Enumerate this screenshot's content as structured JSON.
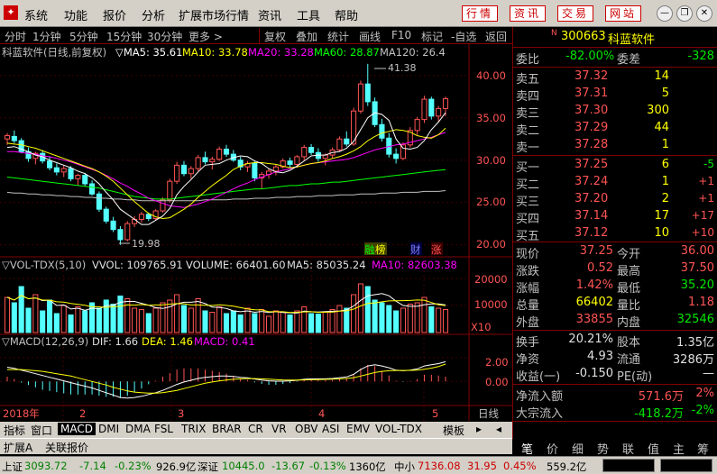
{
  "menu": {
    "items": [
      "系统",
      "功能",
      "报价",
      "分析",
      "扩展市场行情",
      "资讯",
      "工具",
      "帮助"
    ],
    "right_buttons": [
      "行情",
      "资讯",
      "交易",
      "网站"
    ]
  },
  "toolbar": {
    "periods": [
      "分时",
      "1分钟",
      "5分钟",
      "15分钟",
      "30分钟",
      "更多 >"
    ],
    "buttons": [
      "复权",
      "叠加",
      "统计",
      "画线",
      "F10",
      "标记",
      "-自选",
      "返回"
    ]
  },
  "main": {
    "title": "科蓝软件(日线,前复权)",
    "ma_labels": [
      "▽MA5: 35.61",
      "MA10: 33.78",
      "MA20: 33.28",
      "MA60: 28.87",
      "MA120: 26.4"
    ],
    "ma_colors": [
      "#ffffff",
      "#ffff00",
      "#ff00ff",
      "#00ff00",
      "#c0c0c0"
    ],
    "price_ticks": [
      "40.00",
      "35.00",
      "30.00",
      "25.00",
      "20.00"
    ],
    "high_label": "41.38",
    "low_label": "19.98",
    "marks": [
      "融",
      "榜",
      "财",
      "涨"
    ]
  },
  "volume": {
    "title": "▽VOL-TDX(5,10)",
    "labels": [
      "VVOL: 109765.91",
      "VOLUME: 66401.60",
      "MA5: 85035.24",
      "MA10: 82603.38"
    ],
    "ticks": [
      "20000",
      "10000",
      "X10"
    ]
  },
  "macd": {
    "title": "▽MACD(12,26,9)",
    "labels": [
      "DIF: 1.66",
      "DEA: 1.46",
      "MACD: 0.41"
    ],
    "ticks": [
      "2.00",
      "0.00"
    ]
  },
  "xaxis": {
    "labels": [
      "2018年",
      "2",
      "3",
      "4",
      "5"
    ],
    "period_label": "日线"
  },
  "quote": {
    "code": "300663",
    "name": "科蓝软件",
    "weibi_label": "委比",
    "weibi": "-82.00%",
    "weicha_label": "委差",
    "weicha": "-328",
    "asks": [
      {
        "label": "卖五",
        "price": "37.32",
        "vol": "14"
      },
      {
        "label": "卖四",
        "price": "37.31",
        "vol": "5"
      },
      {
        "label": "卖三",
        "price": "37.30",
        "vol": "300"
      },
      {
        "label": "卖二",
        "price": "37.29",
        "vol": "44"
      },
      {
        "label": "卖一",
        "price": "37.28",
        "vol": "1"
      }
    ],
    "bids": [
      {
        "label": "买一",
        "price": "37.25",
        "vol": "6",
        "chg": "-5"
      },
      {
        "label": "买二",
        "price": "37.24",
        "vol": "1",
        "chg": "+1"
      },
      {
        "label": "买三",
        "price": "37.20",
        "vol": "2",
        "chg": "+1"
      },
      {
        "label": "买四",
        "price": "37.14",
        "vol": "17",
        "chg": "+17"
      },
      {
        "label": "买五",
        "price": "37.12",
        "vol": "10",
        "chg": "+10"
      }
    ],
    "stats": [
      {
        "l1": "现价",
        "v1": "37.25",
        "l2": "今开",
        "v2": "36.00",
        "c1": "red",
        "c2": "red"
      },
      {
        "l1": "涨跌",
        "v1": "0.52",
        "l2": "最高",
        "v2": "37.50",
        "c1": "red",
        "c2": "red"
      },
      {
        "l1": "涨幅",
        "v1": "1.42%",
        "l2": "最低",
        "v2": "35.20",
        "c1": "red",
        "c2": "grn"
      },
      {
        "l1": "总量",
        "v1": "66402",
        "l2": "量比",
        "v2": "1.18",
        "c1": "yel",
        "c2": "red"
      },
      {
        "l1": "外盘",
        "v1": "33855",
        "l2": "内盘",
        "v2": "32546",
        "c1": "red",
        "c2": "grn"
      }
    ],
    "stats2": [
      {
        "l1": "换手",
        "v1": "20.21%",
        "l2": "股本",
        "v2": "1.35亿"
      },
      {
        "l1": "净资",
        "v1": "4.93",
        "l2": "流通",
        "v2": "3286万"
      },
      {
        "l1": "收益(一)",
        "v1": "-0.150",
        "l2": "PE(动)",
        "v2": "—"
      }
    ],
    "flow": [
      {
        "label": "净流入额",
        "value": "571.6万",
        "pct": "2%"
      },
      {
        "label": "大宗流入",
        "value": "-418.2万",
        "pct": "-2%"
      }
    ],
    "tabs": [
      "笔",
      "价",
      "细",
      "势",
      "联",
      "值",
      "主",
      "筹"
    ]
  },
  "bottom_tabs": [
    "指标",
    "窗口",
    "MACD",
    "DMI",
    "DMA",
    "FSL",
    "TRIX",
    "BRAR",
    "CR",
    "VR",
    "OBV",
    "ASI",
    "EMV",
    "VOL-TDX",
    "模板"
  ],
  "bottom_tabs2": [
    "扩展A",
    "关联报价"
  ],
  "status": {
    "sh_label": "上证",
    "sh_val": "3093.72",
    "sh_chg": "-7.14",
    "sh_pct": "-0.23%",
    "sh_amt": "926.9亿",
    "sz_label": "深证",
    "sz_val": "10445.0",
    "sz_chg": "-13.67",
    "sz_pct": "-0.13%",
    "sz_amt": "1360亿",
    "zx_label": "中小",
    "zx_val": "7136.08",
    "zx_chg": "31.95",
    "zx_pct": "0.45%",
    "zx_amt": "559.2亿"
  },
  "chart_data": {
    "type": "candlestick",
    "y_range": [
      19,
      42
    ],
    "candles": [
      [
        32.5,
        33.2,
        31.8,
        32.9
      ],
      [
        32.8,
        33.5,
        32.0,
        32.3
      ],
      [
        32.3,
        32.6,
        30.8,
        31.0
      ],
      [
        31.0,
        31.5,
        29.8,
        30.2
      ],
      [
        30.2,
        31.0,
        29.5,
        30.8
      ],
      [
        30.8,
        31.2,
        29.6,
        29.9
      ],
      [
        29.9,
        30.4,
        28.8,
        29.1
      ],
      [
        29.1,
        29.6,
        28.2,
        28.6
      ],
      [
        28.6,
        29.4,
        28.0,
        29.0
      ],
      [
        29.0,
        29.3,
        27.5,
        27.8
      ],
      [
        27.8,
        28.4,
        27.0,
        28.2
      ],
      [
        28.2,
        28.5,
        26.9,
        27.2
      ],
      [
        27.2,
        27.6,
        25.8,
        26.0
      ],
      [
        26.0,
        26.3,
        23.9,
        24.2
      ],
      [
        24.2,
        24.5,
        22.5,
        22.8
      ],
      [
        22.8,
        23.3,
        21.5,
        21.8
      ],
      [
        21.8,
        22.2,
        19.98,
        20.6
      ],
      [
        20.6,
        22.8,
        20.4,
        22.5
      ],
      [
        22.5,
        23.4,
        22.1,
        23.0
      ],
      [
        23.0,
        23.9,
        22.6,
        23.6
      ],
      [
        23.6,
        23.8,
        22.8,
        23.1
      ],
      [
        23.1,
        24.2,
        22.9,
        24.0
      ],
      [
        24.0,
        25.6,
        23.8,
        25.3
      ],
      [
        25.3,
        27.8,
        25.0,
        27.5
      ],
      [
        27.5,
        29.8,
        27.2,
        29.4
      ],
      [
        29.4,
        29.9,
        28.1,
        28.4
      ],
      [
        28.4,
        29.3,
        27.8,
        29.0
      ],
      [
        29.0,
        30.6,
        28.7,
        30.3
      ],
      [
        30.3,
        31.0,
        29.5,
        29.8
      ],
      [
        29.8,
        30.4,
        28.9,
        30.1
      ],
      [
        30.1,
        31.6,
        29.9,
        31.3
      ],
      [
        31.3,
        31.8,
        30.4,
        30.7
      ],
      [
        30.7,
        31.2,
        29.8,
        30.0
      ],
      [
        30.0,
        30.4,
        28.8,
        29.2
      ],
      [
        29.2,
        29.9,
        28.6,
        29.6
      ],
      [
        29.6,
        29.9,
        27.5,
        27.9
      ],
      [
        27.9,
        28.6,
        26.6,
        28.3
      ],
      [
        28.3,
        29.0,
        27.8,
        28.7
      ],
      [
        28.7,
        29.5,
        28.2,
        29.2
      ],
      [
        29.2,
        30.2,
        29.0,
        29.9
      ],
      [
        29.9,
        30.3,
        29.1,
        29.5
      ],
      [
        29.5,
        30.6,
        29.3,
        30.4
      ],
      [
        30.4,
        31.8,
        30.0,
        31.5
      ],
      [
        31.5,
        31.9,
        30.6,
        30.9
      ],
      [
        30.9,
        31.4,
        29.8,
        30.2
      ],
      [
        30.2,
        30.8,
        29.4,
        30.6
      ],
      [
        30.6,
        31.5,
        30.2,
        31.2
      ],
      [
        31.2,
        32.8,
        31.0,
        32.5
      ],
      [
        32.5,
        33.4,
        31.6,
        31.9
      ],
      [
        31.9,
        36.2,
        31.7,
        35.8
      ],
      [
        35.8,
        39.4,
        35.5,
        39.0
      ],
      [
        39.0,
        41.38,
        36.4,
        36.9
      ],
      [
        36.9,
        37.4,
        33.9,
        34.2
      ],
      [
        34.2,
        34.9,
        32.2,
        32.6
      ],
      [
        32.6,
        33.2,
        30.3,
        30.7
      ],
      [
        30.7,
        31.4,
        29.6,
        30.2
      ],
      [
        30.2,
        32.1,
        30.0,
        31.8
      ],
      [
        31.8,
        33.9,
        31.5,
        33.5
      ],
      [
        33.5,
        35.1,
        33.0,
        34.8
      ],
      [
        34.8,
        37.6,
        34.4,
        37.2
      ],
      [
        37.2,
        37.5,
        34.8,
        35.2
      ],
      [
        35.2,
        36.4,
        34.5,
        36.1
      ],
      [
        36.1,
        37.5,
        35.2,
        37.25
      ]
    ],
    "ma5": [
      31.5,
      31.6,
      31.3,
      31.0,
      30.6,
      30.4,
      30.0,
      29.7,
      29.4,
      29.1,
      28.7,
      28.4,
      27.9,
      27.2,
      26.2,
      25.3,
      24.2,
      23.6,
      23.0,
      22.4,
      22.4,
      22.9,
      23.4,
      24.3,
      25.9,
      26.9,
      27.7,
      28.6,
      29.4,
      29.5,
      29.6,
      30.0,
      30.3,
      30.5,
      30.4,
      29.9,
      29.6,
      29.0,
      28.6,
      28.5,
      28.8,
      29.3,
      29.9,
      30.5,
      30.6,
      30.6,
      30.9,
      31.0,
      31.4,
      32.2,
      33.6,
      35.0,
      35.6,
      35.4,
      34.7,
      32.5,
      31.4,
      31.3,
      31.5,
      32.3,
      33.6,
      34.5,
      35.61
    ],
    "ma10": [
      32.0,
      31.9,
      31.8,
      31.6,
      31.4,
      31.1,
      30.8,
      30.5,
      30.2,
      29.9,
      29.6,
      29.3,
      29.0,
      28.6,
      28.1,
      27.5,
      26.7,
      25.9,
      25.1,
      24.4,
      23.7,
      23.3,
      23.1,
      23.2,
      23.7,
      24.2,
      24.8,
      25.6,
      26.3,
      27.0,
      27.6,
      28.2,
      28.9,
      29.3,
      29.6,
      29.7,
      29.7,
      29.6,
      29.5,
      29.3,
      29.1,
      29.2,
      29.4,
      29.6,
      29.7,
      29.9,
      30.2,
      30.4,
      30.7,
      31.1,
      31.6,
      32.3,
      32.8,
      33.2,
      33.4,
      33.6,
      33.5,
      33.3,
      32.9,
      32.7,
      32.6,
      33.0,
      33.78
    ],
    "ma20": [
      31.0,
      31.0,
      30.9,
      30.8,
      30.7,
      30.5,
      30.4,
      30.2,
      30.0,
      29.8,
      29.5,
      29.2,
      28.9,
      28.6,
      28.2,
      27.8,
      27.3,
      26.9,
      26.4,
      26.0,
      25.5,
      25.2,
      24.9,
      24.6,
      24.5,
      24.4,
      24.6,
      24.8,
      25.1,
      25.4,
      25.8,
      26.2,
      26.6,
      27.0,
      27.3,
      27.7,
      28.0,
      28.3,
      28.6,
      28.8,
      29.0,
      29.2,
      29.4,
      29.6,
      29.7,
      29.8,
      29.9,
      30.0,
      30.1,
      30.3,
      30.6,
      30.9,
      31.2,
      31.4,
      31.6,
      31.8,
      31.9,
      32.1,
      32.3,
      32.5,
      32.7,
      33.0,
      33.28
    ],
    "ma60": [
      28.0,
      27.9,
      27.8,
      27.7,
      27.6,
      27.5,
      27.4,
      27.3,
      27.2,
      27.1,
      27.0,
      26.9,
      26.8,
      26.7,
      26.5,
      26.3,
      26.1,
      25.9,
      25.7,
      25.6,
      25.5,
      25.4,
      25.4,
      25.4,
      25.5,
      25.6,
      25.7,
      25.8,
      25.9,
      26.0,
      26.1,
      26.2,
      26.3,
      26.4,
      26.5,
      26.6,
      26.6,
      26.7,
      26.8,
      26.9,
      27.0,
      27.0,
      27.1,
      27.2,
      27.2,
      27.3,
      27.4,
      27.4,
      27.5,
      27.6,
      27.7,
      27.8,
      27.9,
      28.0,
      28.1,
      28.2,
      28.3,
      28.4,
      28.5,
      28.6,
      28.7,
      28.8,
      28.87
    ],
    "ma120": [
      26.2,
      26.1,
      26.1,
      26.0,
      26.0,
      25.9,
      25.9,
      25.8,
      25.8,
      25.7,
      25.7,
      25.6,
      25.6,
      25.5,
      25.5,
      25.4,
      25.4,
      25.3,
      25.3,
      25.2,
      25.2,
      25.2,
      25.2,
      25.2,
      25.2,
      25.2,
      25.2,
      25.2,
      25.3,
      25.3,
      25.3,
      25.3,
      25.4,
      25.4,
      25.4,
      25.5,
      25.5,
      25.5,
      25.6,
      25.6,
      25.6,
      25.7,
      25.7,
      25.7,
      25.8,
      25.8,
      25.8,
      25.9,
      25.9,
      25.9,
      26.0,
      26.0,
      26.0,
      26.1,
      26.1,
      26.1,
      26.2,
      26.2,
      26.2,
      26.3,
      26.3,
      26.3,
      26.4
    ],
    "volume": [
      13000,
      11000,
      17000,
      9000,
      14000,
      8000,
      12000,
      7000,
      10000,
      6500,
      9500,
      8000,
      11000,
      9000,
      12000,
      10500,
      13500,
      12500,
      9000,
      8500,
      7000,
      9000,
      11000,
      12000,
      14000,
      10000,
      9000,
      12500,
      8000,
      7500,
      9500,
      7000,
      8000,
      6500,
      9000,
      7000,
      8500,
      6000,
      8000,
      7500,
      6500,
      8000,
      9500,
      7000,
      6800,
      7500,
      8500,
      10000,
      9000,
      14000,
      18000,
      17000,
      12000,
      11000,
      10000,
      8000,
      9000,
      10500,
      11000,
      13000,
      9500,
      9000,
      8500
    ],
    "dif": [
      1.2,
      1.1,
      0.95,
      0.8,
      0.65,
      0.5,
      0.35,
      0.2,
      0.05,
      -0.1,
      -0.25,
      -0.4,
      -0.55,
      -0.75,
      -0.95,
      -1.15,
      -1.35,
      -1.4,
      -1.35,
      -1.25,
      -1.1,
      -0.95,
      -0.75,
      -0.5,
      -0.25,
      -0.05,
      0.1,
      0.25,
      0.35,
      0.4,
      0.45,
      0.45,
      0.42,
      0.35,
      0.3,
      0.2,
      0.12,
      0.05,
      0.02,
      0.02,
      0.05,
      0.1,
      0.18,
      0.22,
      0.22,
      0.22,
      0.25,
      0.32,
      0.38,
      0.6,
      1.0,
      1.3,
      1.4,
      1.3,
      1.15,
      0.95,
      0.9,
      0.95,
      1.05,
      1.3,
      1.4,
      1.5,
      1.66
    ],
    "dea": [
      1.0,
      1.0,
      1.0,
      0.95,
      0.9,
      0.85,
      0.75,
      0.65,
      0.55,
      0.45,
      0.3,
      0.15,
      0.0,
      -0.15,
      -0.3,
      -0.5,
      -0.65,
      -0.8,
      -0.9,
      -0.95,
      -0.98,
      -0.98,
      -0.95,
      -0.85,
      -0.75,
      -0.6,
      -0.45,
      -0.3,
      -0.15,
      -0.05,
      0.05,
      0.12,
      0.18,
      0.22,
      0.24,
      0.24,
      0.22,
      0.19,
      0.16,
      0.13,
      0.12,
      0.12,
      0.13,
      0.14,
      0.16,
      0.17,
      0.19,
      0.22,
      0.25,
      0.32,
      0.45,
      0.6,
      0.75,
      0.85,
      0.9,
      0.92,
      0.92,
      0.93,
      0.95,
      1.02,
      1.12,
      1.25,
      1.46
    ]
  }
}
